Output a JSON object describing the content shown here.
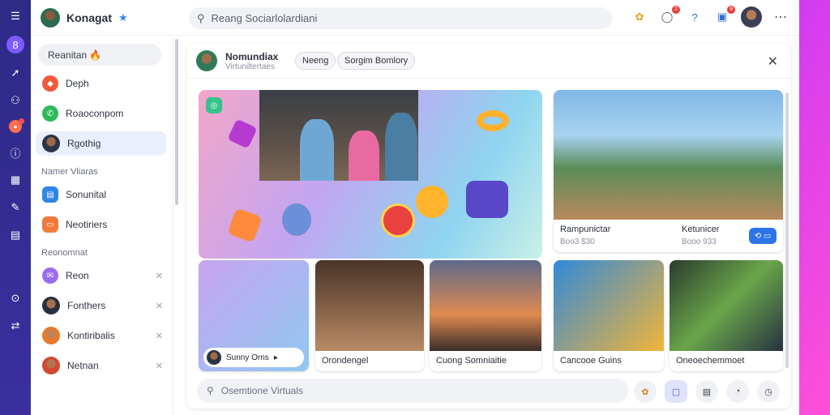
{
  "rail": {
    "items": [
      {
        "icon": "menu-icon",
        "glyph": "☰"
      },
      {
        "icon": "app-logo-icon",
        "glyph": "8"
      },
      {
        "icon": "pin-icon",
        "glyph": "➚"
      },
      {
        "icon": "people-icon",
        "glyph": "⚇"
      },
      {
        "icon": "notification-icon",
        "glyph": "●"
      },
      {
        "icon": "info-icon",
        "glyph": "ⓘ"
      },
      {
        "icon": "calendar-icon",
        "glyph": "▦"
      },
      {
        "icon": "pen-icon",
        "glyph": "✎"
      },
      {
        "icon": "grid-icon",
        "glyph": "▤"
      },
      {
        "icon": "settings-icon",
        "glyph": "⊙"
      },
      {
        "icon": "share-icon",
        "glyph": "⇄"
      }
    ]
  },
  "header": {
    "brand": "Konagat",
    "search_placeholder": "Reang Sociarlolardiani",
    "badges": {
      "alerts": "2",
      "messages": "9"
    }
  },
  "sidebar": {
    "top_pill": "Reanitan 🔥",
    "primary": [
      {
        "label": "Deph",
        "color": "#f05a3a"
      },
      {
        "label": "Roaoconpom",
        "color": "#2fb85a"
      },
      {
        "label": "Rgothig",
        "color": "#3a6fd8"
      }
    ],
    "section1": "Namer Vliaras",
    "secondary": [
      {
        "label": "Sonunital",
        "color": "#2f86e6"
      },
      {
        "label": "Neotiriers",
        "color": "#f07a3a"
      }
    ],
    "section2": "Reonomnat",
    "contacts": [
      {
        "label": "Reon"
      },
      {
        "label": "Fonthers"
      },
      {
        "label": "Kontiribalis"
      },
      {
        "label": "Netnan"
      }
    ]
  },
  "panel": {
    "title": "Nomundiax",
    "subtitle": "Virtuniltertaes",
    "chips": [
      "Neeng",
      "Sorgim Bomlory"
    ],
    "cards": [
      {
        "caption": "Rampunictar",
        "meta": "Boo3 $30",
        "button": "+"
      },
      {
        "caption": "Ketunicer",
        "meta": "Booo 933",
        "button": "↻"
      },
      {
        "caption": "Sunny Orns",
        "meta": ""
      },
      {
        "caption": "Orondengel",
        "meta": ""
      },
      {
        "caption": "Cuong Somniaitie",
        "meta": ""
      },
      {
        "caption": "Cancooe Guins",
        "meta": ""
      },
      {
        "caption": "Oneoechemmoet",
        "meta": ""
      }
    ],
    "bottom_search_placeholder": "Osemtione Virtuals"
  }
}
